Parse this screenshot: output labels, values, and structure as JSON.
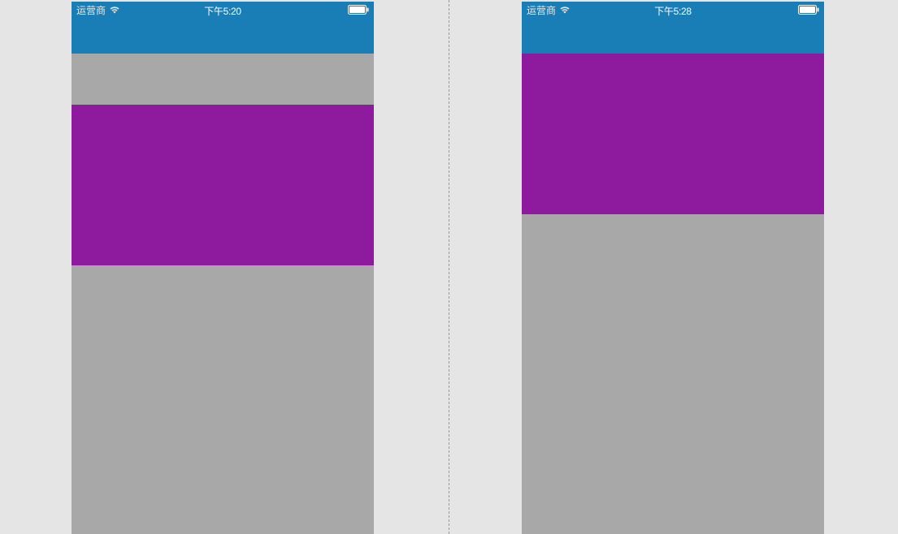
{
  "screens": {
    "left": {
      "carrier": "运营商",
      "time": "下午5:20"
    },
    "right": {
      "carrier": "运营商",
      "time": "下午5:28"
    }
  },
  "colors": {
    "status_bar": "#1a7eb6",
    "purple_block": "#8e1a9e",
    "background": "#a8a8a8"
  }
}
